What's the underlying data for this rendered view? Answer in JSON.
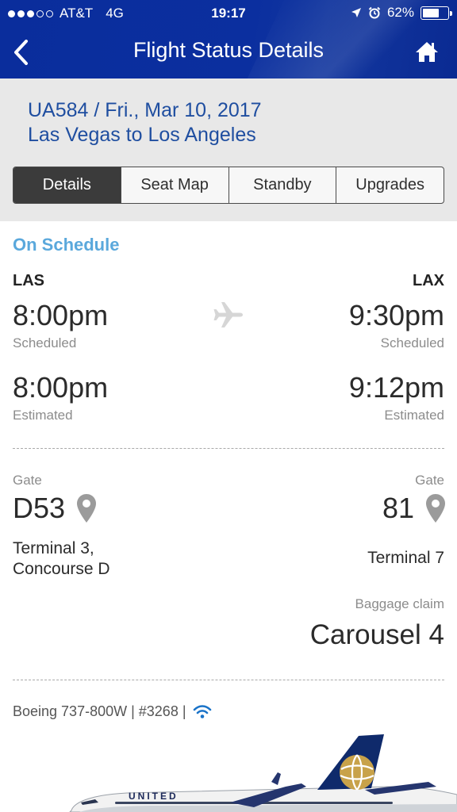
{
  "status_bar": {
    "carrier": "AT&T",
    "network": "4G",
    "time": "19:17",
    "battery": "62%",
    "signal_filled": 3,
    "signal_total": 5
  },
  "nav": {
    "title": "Flight Status Details",
    "back_icon": "chevron-left-icon",
    "home_icon": "home-icon"
  },
  "flight": {
    "line1": "UA584 / Fri., Mar 10, 2017",
    "line2": "Las Vegas to Los Angeles"
  },
  "tabs": [
    {
      "label": "Details",
      "active": true
    },
    {
      "label": "Seat Map",
      "active": false
    },
    {
      "label": "Standby",
      "active": false
    },
    {
      "label": "Upgrades",
      "active": false
    }
  ],
  "details": {
    "status": "On Schedule",
    "origin": {
      "code": "LAS",
      "scheduled_time": "8:00pm",
      "scheduled_label": "Scheduled",
      "estimated_time": "8:00pm",
      "estimated_label": "Estimated",
      "gate_label": "Gate",
      "gate": "D53",
      "terminal_line1": "Terminal 3,",
      "terminal_line2": "Concourse D"
    },
    "destination": {
      "code": "LAX",
      "scheduled_time": "9:30pm",
      "scheduled_label": "Scheduled",
      "estimated_time": "9:12pm",
      "estimated_label": "Estimated",
      "gate_label": "Gate",
      "gate": "81",
      "terminal": "Terminal 7",
      "baggage_label": "Baggage claim",
      "baggage": "Carousel 4"
    }
  },
  "aircraft": {
    "info": "Boeing 737-800W | #3268 |",
    "wifi_icon": "wifi-icon",
    "livery_text": "UNITED"
  },
  "colors": {
    "header": "#0b2f9f",
    "status": "#5aa8dc",
    "flight_text": "#1f4ea0",
    "panel": "#e8e8e8"
  }
}
